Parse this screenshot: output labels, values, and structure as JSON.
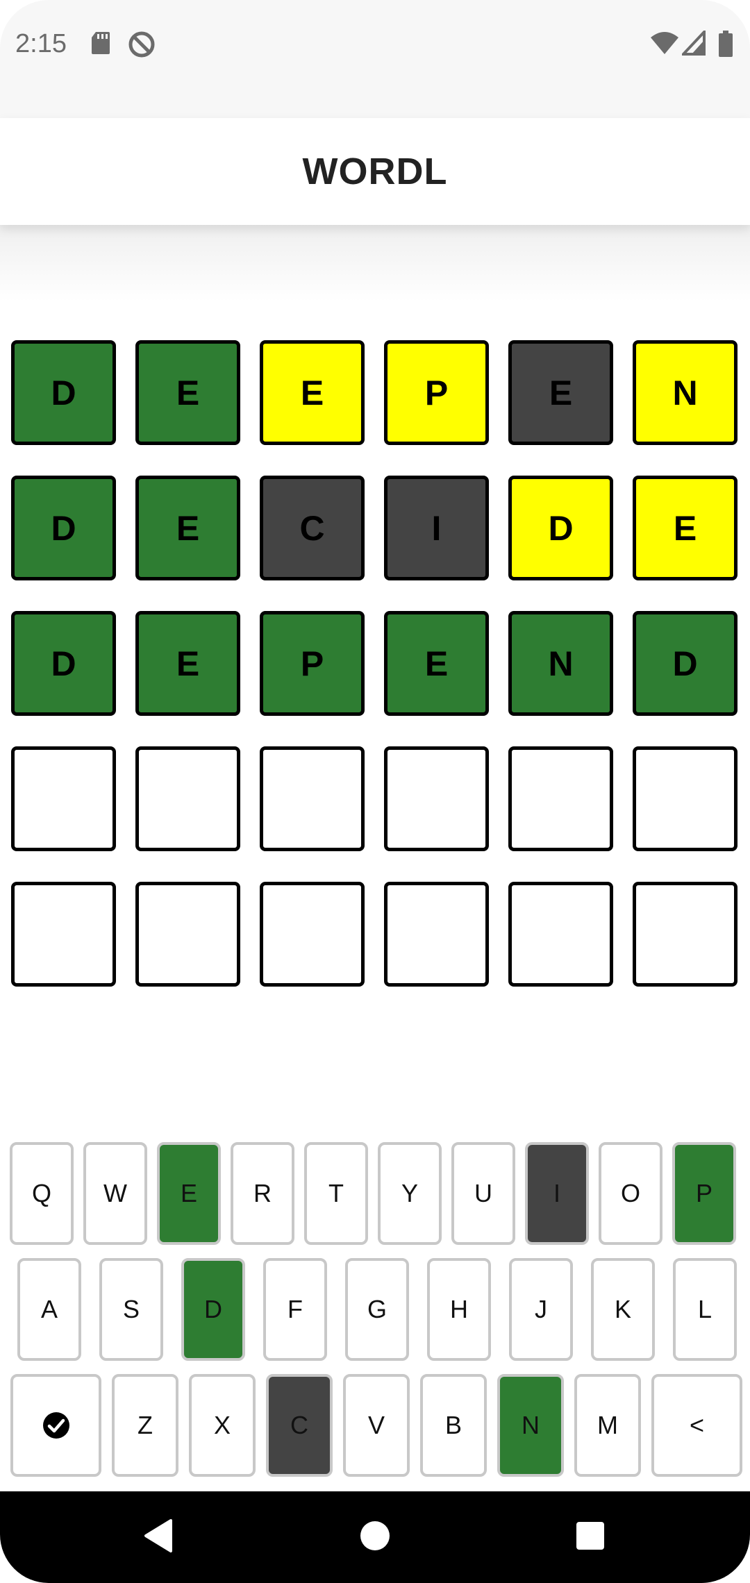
{
  "status": {
    "time": "2:15"
  },
  "app": {
    "title": "WORDL"
  },
  "board": {
    "rows": [
      [
        {
          "l": "D",
          "s": "green"
        },
        {
          "l": "E",
          "s": "green"
        },
        {
          "l": "E",
          "s": "yellow"
        },
        {
          "l": "P",
          "s": "yellow"
        },
        {
          "l": "E",
          "s": "gray"
        },
        {
          "l": "N",
          "s": "yellow"
        }
      ],
      [
        {
          "l": "D",
          "s": "green"
        },
        {
          "l": "E",
          "s": "green"
        },
        {
          "l": "C",
          "s": "gray"
        },
        {
          "l": "I",
          "s": "gray"
        },
        {
          "l": "D",
          "s": "yellow"
        },
        {
          "l": "E",
          "s": "yellow"
        }
      ],
      [
        {
          "l": "D",
          "s": "green"
        },
        {
          "l": "E",
          "s": "green"
        },
        {
          "l": "P",
          "s": "green"
        },
        {
          "l": "E",
          "s": "green"
        },
        {
          "l": "N",
          "s": "green"
        },
        {
          "l": "D",
          "s": "green"
        }
      ],
      [
        {
          "l": "",
          "s": "empty"
        },
        {
          "l": "",
          "s": "empty"
        },
        {
          "l": "",
          "s": "empty"
        },
        {
          "l": "",
          "s": "empty"
        },
        {
          "l": "",
          "s": "empty"
        },
        {
          "l": "",
          "s": "empty"
        }
      ],
      [
        {
          "l": "",
          "s": "empty"
        },
        {
          "l": "",
          "s": "empty"
        },
        {
          "l": "",
          "s": "empty"
        },
        {
          "l": "",
          "s": "empty"
        },
        {
          "l": "",
          "s": "empty"
        },
        {
          "l": "",
          "s": "empty"
        }
      ]
    ]
  },
  "keyboard": {
    "rows": [
      [
        {
          "k": "Q",
          "s": "none"
        },
        {
          "k": "W",
          "s": "none"
        },
        {
          "k": "E",
          "s": "green"
        },
        {
          "k": "R",
          "s": "none"
        },
        {
          "k": "T",
          "s": "none"
        },
        {
          "k": "Y",
          "s": "none"
        },
        {
          "k": "U",
          "s": "none"
        },
        {
          "k": "I",
          "s": "gray"
        },
        {
          "k": "O",
          "s": "none"
        },
        {
          "k": "P",
          "s": "green"
        }
      ],
      [
        {
          "k": "A",
          "s": "none"
        },
        {
          "k": "S",
          "s": "none"
        },
        {
          "k": "D",
          "s": "green"
        },
        {
          "k": "F",
          "s": "none"
        },
        {
          "k": "G",
          "s": "none"
        },
        {
          "k": "H",
          "s": "none"
        },
        {
          "k": "J",
          "s": "none"
        },
        {
          "k": "K",
          "s": "none"
        },
        {
          "k": "L",
          "s": "none"
        }
      ],
      [
        {
          "k": "✔",
          "s": "none",
          "icon": "check-circle-icon",
          "wide": true
        },
        {
          "k": "Z",
          "s": "none"
        },
        {
          "k": "X",
          "s": "none"
        },
        {
          "k": "C",
          "s": "gray"
        },
        {
          "k": "V",
          "s": "none"
        },
        {
          "k": "B",
          "s": "none"
        },
        {
          "k": "N",
          "s": "green"
        },
        {
          "k": "M",
          "s": "none"
        },
        {
          "k": "<",
          "s": "none",
          "icon": "backspace-icon",
          "wide": true
        }
      ]
    ]
  },
  "colors": {
    "green": "#2e7d32",
    "yellow": "#ffff00",
    "gray": "#444444"
  }
}
